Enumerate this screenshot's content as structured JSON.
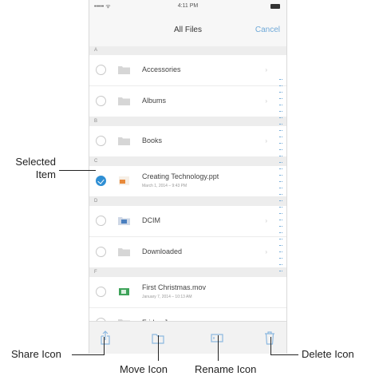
{
  "status": {
    "carrier": "••••• ᯤ",
    "time": "4:11 PM"
  },
  "nav": {
    "title": "All Files",
    "cancel_label": "Cancel"
  },
  "sections": {
    "a": "A",
    "b": "B",
    "c": "C",
    "d": "D",
    "f": "F"
  },
  "rows": [
    {
      "name": "Accessories",
      "icon": "folder-icon"
    },
    {
      "name": "Albums",
      "icon": "folder-icon"
    },
    {
      "name": "Books",
      "icon": "folder-icon"
    },
    {
      "name": "Creating Technology.ppt",
      "detail": "March 1, 2014 – 9:43 PM",
      "icon": "presentation-file-icon",
      "selected": true
    },
    {
      "name": "DCIM",
      "icon": "photo-folder-icon"
    },
    {
      "name": "Downloaded",
      "icon": "folder-icon"
    },
    {
      "name": "First Christmas.mov",
      "detail": "January 7, 2014 – 10:13 AM",
      "icon": "video-file-icon"
    },
    {
      "name": "Friday Jams",
      "icon": "folder-icon"
    }
  ],
  "callouts": {
    "selected_item": "Selected\nItem",
    "share": "Share Icon",
    "move": "Move Icon",
    "rename": "Rename Icon",
    "delete": "Delete Icon"
  },
  "colors": {
    "accent": "#2f8fd4",
    "folder": "#d6d6d6"
  }
}
